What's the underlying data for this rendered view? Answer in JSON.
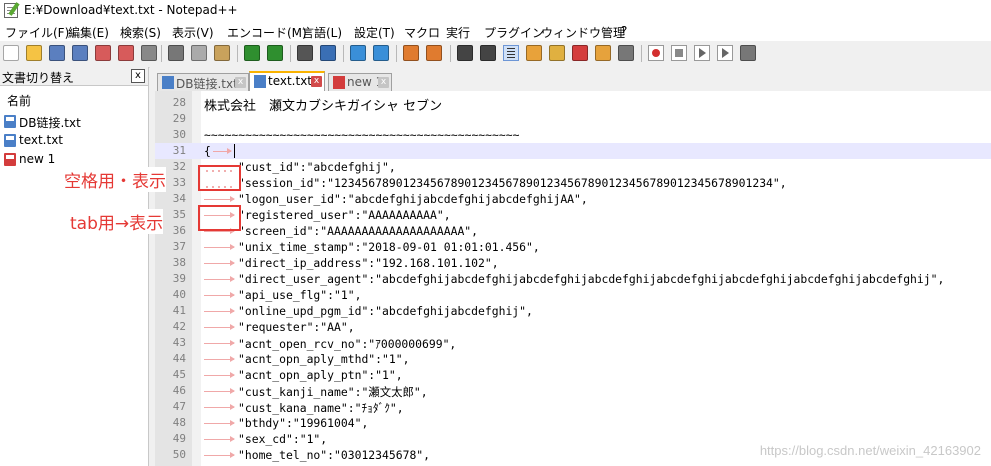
{
  "window": {
    "title": "E:¥Download¥text.txt - Notepad++"
  },
  "menu": [
    "ファイル(F)",
    "編集(E)",
    "検索(S)",
    "表示(V)",
    "エンコード(M)",
    "言語(L)",
    "設定(T)",
    "マクロ",
    "実行",
    "プラグイン",
    "ウィンドウ管理",
    "?"
  ],
  "toolbar": {
    "icons": [
      "new-file-icon",
      "open-file-icon",
      "save-icon",
      "save-all-icon",
      "close-icon",
      "close-all-icon",
      "print-icon",
      "cut-icon",
      "copy-icon",
      "paste-icon",
      "undo-icon",
      "redo-icon",
      "find-icon",
      "replace-icon",
      "zoom-in-icon",
      "zoom-out-icon",
      "sync-vertical-icon",
      "sync-horizontal-icon",
      "word-wrap-icon",
      "show-all-chars-icon",
      "indent-guide-icon",
      "udl-icon",
      "doc-map-icon",
      "function-list-icon",
      "folder-workspace-icon",
      "monitor-icon",
      "record-macro-icon",
      "stop-macro-icon",
      "play-macro-icon",
      "play-multiple-icon",
      "save-macro-icon"
    ]
  },
  "doc_switcher": {
    "title": "文書切り替え",
    "close_label": "x",
    "column_header": "名前",
    "files": [
      {
        "label": "DB链接.txt",
        "icon": "saved-file-icon",
        "color": "#4a7fc7"
      },
      {
        "label": "text.txt",
        "icon": "saved-file-icon",
        "color": "#4a7fc7"
      },
      {
        "label": "new 1",
        "icon": "unsaved-file-icon",
        "color": "#d33c3c"
      }
    ]
  },
  "tabs": [
    {
      "label": "DB链接.txt",
      "active": false
    },
    {
      "label": "text.txt",
      "active": true
    },
    {
      "label": "new 1",
      "active": false
    }
  ],
  "editor": {
    "lines": [
      {
        "n": "28",
        "text": "株式会社　瀬文カブシキガイシャ セブン",
        "prefix": "jp"
      },
      {
        "n": "29",
        "text": "",
        "prefix": "none"
      },
      {
        "n": "30",
        "text": "~~~~~~~~~~~~~~~~~~~~~~~~~~~~~~~~~~~~~~~~~~~~~~",
        "prefix": "none"
      },
      {
        "n": "31",
        "text": "{",
        "prefix": "brace"
      },
      {
        "n": "32",
        "text": "\"cust_id\":\"abcdefghij\",",
        "prefix": "space"
      },
      {
        "n": "33",
        "text": "\"session_id\":\"1234567890123456789012345678901234567890123456789012345678901234\",",
        "prefix": "space"
      },
      {
        "n": "34",
        "text": "\"logon_user_id\":\"abcdefghijabcdefghijabcdefghijAA\",",
        "prefix": "tab"
      },
      {
        "n": "35",
        "text": "\"registered_user\":\"AAAAAAAAAA\",",
        "prefix": "tab"
      },
      {
        "n": "36",
        "text": "\"screen_id\":\"AAAAAAAAAAAAAAAAAAAA\",",
        "prefix": "tab"
      },
      {
        "n": "37",
        "text": "\"unix_time_stamp\":\"2018-09-01 01:01:01.456\",",
        "prefix": "tab"
      },
      {
        "n": "38",
        "text": "\"direct_ip_address\":\"192.168.101.102\",",
        "prefix": "tab"
      },
      {
        "n": "39",
        "text": "\"direct_user_agent\":\"abcdefghijabcdefghijabcdefghijabcdefghijabcdefghijabcdefghijabcdefghijabcdefghij\",",
        "prefix": "tab"
      },
      {
        "n": "40",
        "text": "\"api_use_flg\":\"1\",",
        "prefix": "tab"
      },
      {
        "n": "41",
        "text": "\"online_upd_pgm_id\":\"abcdefghijabcdefghij\",",
        "prefix": "tab"
      },
      {
        "n": "42",
        "text": "\"requester\":\"AA\",",
        "prefix": "tab"
      },
      {
        "n": "43",
        "text": "\"acnt_open_rcv_no\":\"ｱ000000699\",",
        "prefix": "tab"
      },
      {
        "n": "44",
        "text": "\"acnt_opn_aply_mthd\":\"1\",",
        "prefix": "tab"
      },
      {
        "n": "45",
        "text": "\"acnt_opn_aply_ptn\":\"1\",",
        "prefix": "tab"
      },
      {
        "n": "46",
        "text": "\"cust_kanji_name\":\"瀬文太郎\",",
        "prefix": "tab"
      },
      {
        "n": "47",
        "text": "\"cust_kana_name\":\"ﾁｮﾀﾞｸ\",",
        "prefix": "tab"
      },
      {
        "n": "48",
        "text": "\"bthdy\":\"19961004\",",
        "prefix": "tab"
      },
      {
        "n": "49",
        "text": "\"sex_cd\":\"1\",",
        "prefix": "tab"
      },
      {
        "n": "50",
        "text": "\"home_tel_no\":\"03012345678\",",
        "prefix": "tab"
      }
    ]
  },
  "annotations": {
    "space_label": "空格用・表示",
    "tab_label": "tab用→表示",
    "color": "#e53935"
  },
  "watermark": "https://blog.csdn.net/weixin_42163902"
}
